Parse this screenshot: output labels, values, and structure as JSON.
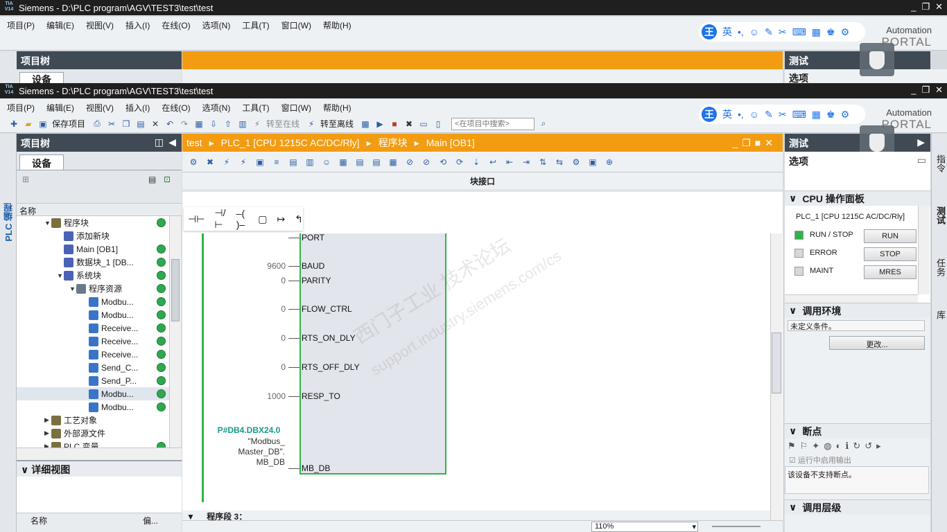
{
  "app": {
    "title": "Siemens  -  D:\\PLC program\\AGV\\TEST3\\test\\test",
    "logo_text": "TIA V14",
    "brand_line1": "Automation",
    "brand_line2": "PORTAL"
  },
  "menu": [
    "项目(P)",
    "编辑(E)",
    "视图(V)",
    "插入(I)",
    "在线(O)",
    "选项(N)",
    "工具(T)",
    "窗口(W)",
    "帮助(H)"
  ],
  "toolbar": {
    "save_label": "保存项目",
    "go_online": "转至在线",
    "go_offline": "转至离线",
    "search_placeholder": "<在项目中搜索>"
  },
  "ime": {
    "w": "王",
    "lang": "英",
    "punct": "•,"
  },
  "project_tree": {
    "title": "项目树",
    "tab": "设备",
    "col_name": "名称",
    "items": [
      {
        "label": "程序块",
        "level": 2,
        "arrow": "▼",
        "dot": true
      },
      {
        "label": "添加新块",
        "level": 3,
        "arrow": "",
        "dot": false
      },
      {
        "label": "Main [OB1]",
        "level": 3,
        "arrow": "",
        "dot": true
      },
      {
        "label": "数据块_1 [DB...",
        "level": 3,
        "arrow": "",
        "dot": true
      },
      {
        "label": "系统块",
        "level": 3,
        "arrow": "▼",
        "dot": true
      },
      {
        "label": "程序资源",
        "level": 4,
        "arrow": "▼",
        "dot": true
      },
      {
        "label": "Modbu...",
        "level": 5,
        "arrow": "",
        "dot": true
      },
      {
        "label": "Modbu...",
        "level": 5,
        "arrow": "",
        "dot": true
      },
      {
        "label": "Receive...",
        "level": 5,
        "arrow": "",
        "dot": true
      },
      {
        "label": "Receive...",
        "level": 5,
        "arrow": "",
        "dot": true
      },
      {
        "label": "Receive...",
        "level": 5,
        "arrow": "",
        "dot": true
      },
      {
        "label": "Send_C...",
        "level": 5,
        "arrow": "",
        "dot": true
      },
      {
        "label": "Send_P...",
        "level": 5,
        "arrow": "",
        "dot": true
      },
      {
        "label": "Modbu...",
        "level": 5,
        "arrow": "",
        "dot": true
      },
      {
        "label": "Modbu...",
        "level": 5,
        "arrow": "",
        "dot": true
      },
      {
        "label": "工艺对象",
        "level": 2,
        "arrow": "▶",
        "dot": false
      },
      {
        "label": "外部源文件",
        "level": 2,
        "arrow": "▶",
        "dot": false
      },
      {
        "label": "PLC 变量",
        "level": 2,
        "arrow": "▶",
        "dot": true
      }
    ],
    "detail_title": "详细视图",
    "detail_col_name": "名称",
    "detail_col_addr": "偏..."
  },
  "left_vtab": "PLC 编程",
  "breadcrumb": [
    "test",
    "PLC_1 [CPU 1215C AC/DC/Rly]",
    "程序块",
    "Main [OB1]"
  ],
  "editor": {
    "block_interface": "块接口",
    "network_label": "程序段 3：",
    "zoom": "110%",
    "params": [
      {
        "pin": "PORT",
        "value": ""
      },
      {
        "pin": "BAUD",
        "value": "9600"
      },
      {
        "pin": "PARITY",
        "value": "0"
      },
      {
        "pin": "FLOW_CTRL",
        "value": "0"
      },
      {
        "pin": "RTS_ON_DLY",
        "value": "0"
      },
      {
        "pin": "RTS_OFF_DLY",
        "value": "0"
      },
      {
        "pin": "RESP_TO",
        "value": "1000"
      },
      {
        "pin": "MB_DB",
        "value": ""
      }
    ],
    "mbdb_addr": "P#DB4.DBX24.0",
    "mbdb_sym1": "\"Modbus_",
    "mbdb_sym2": "Master_DB\".",
    "mbdb_sym3": "MB_DB"
  },
  "watermark": {
    "line1": "西门子工业  技术论坛",
    "line2": "support.industry.siemens.com/cs"
  },
  "right_panel": {
    "title": "测试",
    "options": "选项",
    "cpu_panel": "CPU 操作面板",
    "plc": "PLC_1 [CPU 1215C AC/DC/Rly]",
    "rows": [
      {
        "label": "RUN / STOP",
        "button": "RUN",
        "color": "#2fb34a"
      },
      {
        "label": "ERROR",
        "button": "STOP",
        "color": "#d8d8d8"
      },
      {
        "label": "MAINT",
        "button": "MRES",
        "color": "#d8d8d8"
      }
    ],
    "call_env": "调用环境",
    "call_env_value": "未定义条件。",
    "change_btn": "更改...",
    "breakpoints": "断点",
    "enable_output": "运行中启用输出",
    "bp_msg": "该设备不支持断点。",
    "call_hierarchy": "调用层级"
  },
  "right_vtabs": [
    "指令",
    "测试",
    "任务",
    "库"
  ]
}
